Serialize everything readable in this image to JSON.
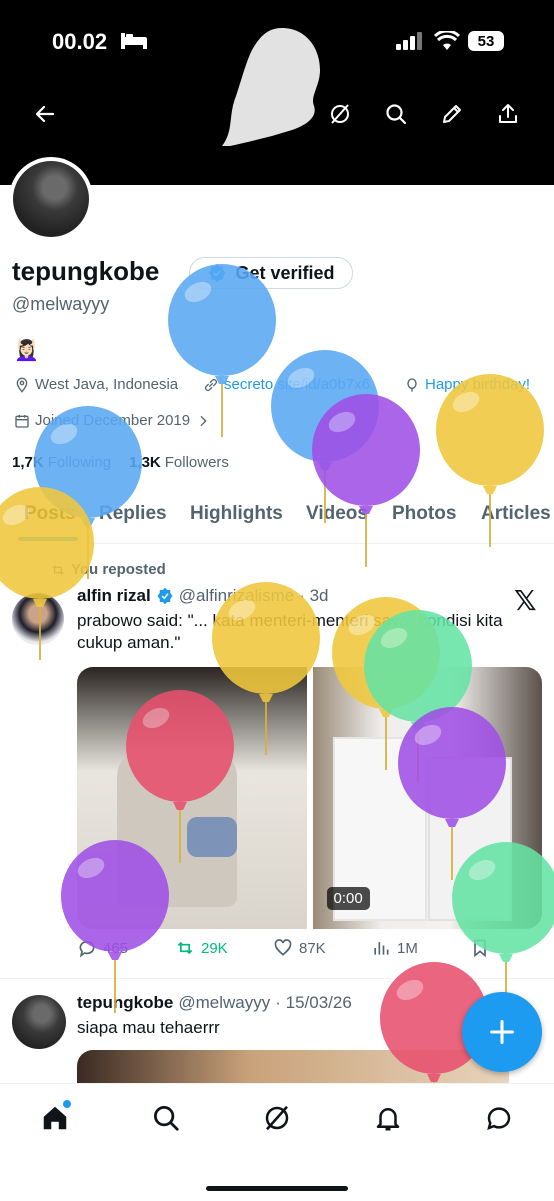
{
  "status_bar": {
    "time": "00.02",
    "battery": "53"
  },
  "header": {
    "back_icon": "arrow-left-icon",
    "actions": [
      "grok-icon",
      "search-icon",
      "edit-icon",
      "share-icon"
    ]
  },
  "profile": {
    "name": "tepungkobe",
    "verify_label": "Get verified",
    "handle": "@melwayyy",
    "emoji": "💆🏻‍♀️",
    "location": "West Java, Indonesia",
    "website": "secreto.site/id/a0b7x6",
    "birthday": "Happy birthday!",
    "joined": "Joined December 2019",
    "following_count": "1,7K",
    "following_label": "Following",
    "followers_count": "1,3K",
    "followers_label": "Followers"
  },
  "tabs": [
    "Posts",
    "Replies",
    "Highlights",
    "Videos",
    "Photos",
    "Articles"
  ],
  "feed": [
    {
      "repost_label": "You reposted",
      "author": "alfin rizal",
      "handle": "@alfinrizalisme",
      "time": "· 3d",
      "text": "prabowo said: \"... kata menteri-menteri saya, kondisi kita cukup aman.\"",
      "video_time": "0:00",
      "stats": {
        "replies": "465",
        "reposts": "29K",
        "likes": "87K",
        "views": "1M"
      }
    },
    {
      "author": "tepungkobe",
      "handle": "@melwayyy",
      "time": "· 15/03/26",
      "text": "siapa mau tehaerrr"
    }
  ],
  "colors": {
    "accent": "#1d9bf0",
    "repost_green": "#00ba7c",
    "text": "#0f1419",
    "secondary": "#536471"
  },
  "balloons": [
    {
      "color": "#5aa9f3"
    },
    {
      "color": "#5aa9f3"
    },
    {
      "color": "#5aa9f3"
    },
    {
      "color": "#a050e6"
    },
    {
      "color": "#f0c83c"
    },
    {
      "color": "#f0c83c"
    },
    {
      "color": "#f0c83c"
    },
    {
      "color": "#f0c83c"
    },
    {
      "color": "#66e3a4"
    },
    {
      "color": "#a050e6"
    },
    {
      "color": "#e8506e"
    },
    {
      "color": "#a050e6"
    },
    {
      "color": "#66e3a4"
    },
    {
      "color": "#e8506e"
    }
  ],
  "bottom_nav": [
    "home-icon",
    "search-icon",
    "grok-icon",
    "notifications-icon",
    "messages-icon"
  ]
}
